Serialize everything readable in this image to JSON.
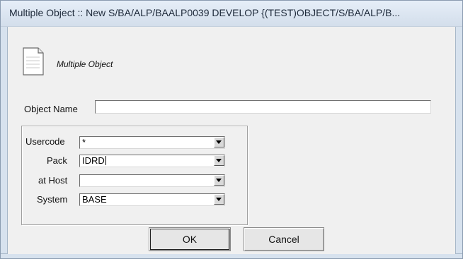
{
  "window": {
    "title": "Multiple Object :: New S/BA/ALP/BAALP0039 DEVELOP {(TEST)OBJECT/S/BA/ALP/B..."
  },
  "header": {
    "icon": "document-icon",
    "label": "Multiple Object"
  },
  "form": {
    "object_name": {
      "label": "Object Name",
      "value": ""
    },
    "usercode": {
      "label": "Usercode",
      "value": "*"
    },
    "pack": {
      "label": "Pack",
      "value": "IDRD"
    },
    "at_host": {
      "label": "at Host",
      "value": ""
    },
    "system": {
      "label": "System",
      "value": "BASE"
    }
  },
  "buttons": {
    "ok": "OK",
    "cancel": "Cancel"
  }
}
